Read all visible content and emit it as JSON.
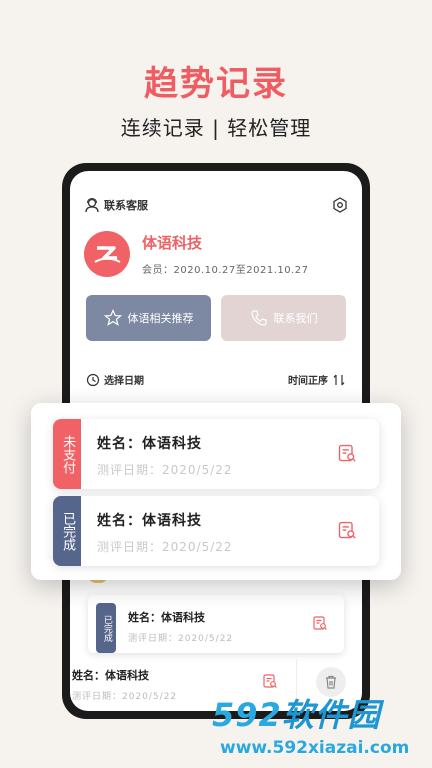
{
  "hero": {
    "title": "趋势记录",
    "subtitle": "连续记录 | 轻松管理"
  },
  "app": {
    "customer_service": "联系客服",
    "profile": {
      "name": "体语科技",
      "member": "会员：2020.10.27至2021.10.27"
    },
    "buttons": {
      "recommend": "体语相关推荐",
      "contact": "联系我们"
    },
    "filter": {
      "date": "选择日期",
      "sort": "时间正序"
    },
    "bg_card": {
      "status": "已完成",
      "name": "姓名：体语科技",
      "date": "测评日期：2020/5/22"
    },
    "swipe_row": {
      "name": "姓名：体语科技",
      "date": "测评日期：2020/5/22"
    }
  },
  "popup": {
    "cards": [
      {
        "status": "未支付",
        "name": "姓名：体语科技",
        "date": "测评日期：2020/5/22",
        "color": "#f06266"
      },
      {
        "status": "已完成",
        "name": "姓名：体语科技",
        "date": "测评日期：2020/5/22",
        "color": "#56658c"
      }
    ]
  },
  "watermark": {
    "brand_num": "592",
    "brand_cn": "软件园",
    "url": "www.592xiazai.com"
  },
  "colors": {
    "accent": "#ef5d62",
    "navy": "#56658c",
    "button_blue": "#7d88a3",
    "button_pink": "#e3d4d4"
  },
  "icons": [
    "user-service-icon",
    "gear-icon",
    "star-icon",
    "phone-icon",
    "clock-icon",
    "sort-icon",
    "report-icon",
    "trash-icon"
  ]
}
